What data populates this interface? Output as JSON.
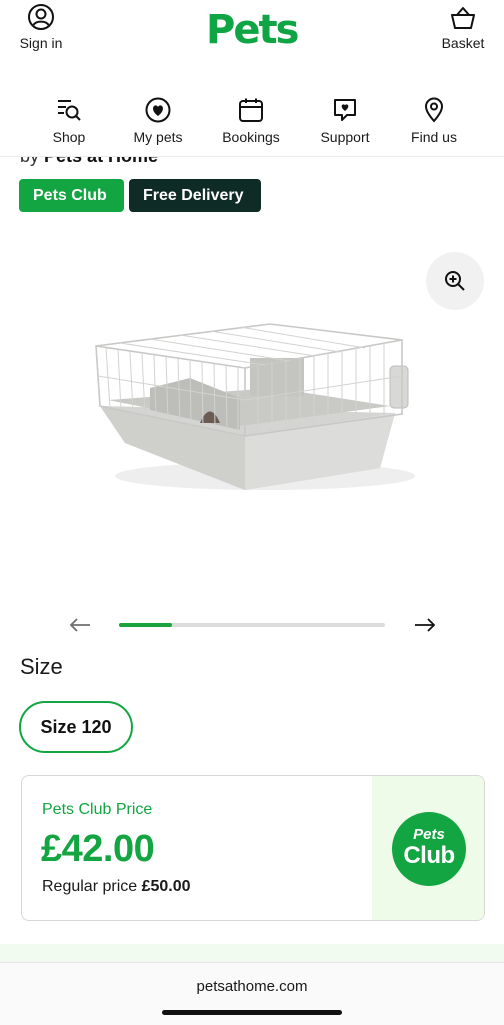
{
  "header": {
    "sign_in_label": "Sign in",
    "logo_text": "Pets",
    "basket_label": "Basket"
  },
  "nav": [
    {
      "label": "Shop",
      "icon": "shop-search-icon"
    },
    {
      "label": "My pets",
      "icon": "heart-icon"
    },
    {
      "label": "Bookings",
      "icon": "calendar-icon"
    },
    {
      "label": "Support",
      "icon": "chat-heart-icon"
    },
    {
      "label": "Find us",
      "icon": "location-pin-icon"
    }
  ],
  "product": {
    "brand_prefix": "by",
    "brand_name": "Pets at Home",
    "tags": [
      "Pets Club",
      "Free Delivery"
    ],
    "image_icon": "rabbit-cage-image",
    "gallery_progress": 0.2
  },
  "size": {
    "label": "Size",
    "selected": "Size 120"
  },
  "price": {
    "club_title": "Pets Club Price",
    "club_price": "£42.00",
    "regular_label": "Regular price",
    "regular_price": "£50.00",
    "badge_top": "Pets",
    "badge_bottom": "Club"
  },
  "browser": {
    "url": "petsathome.com"
  },
  "colors": {
    "brand_green": "#13a541",
    "dark_green": "#0f2b25",
    "club_panel": "#eefbe9"
  }
}
